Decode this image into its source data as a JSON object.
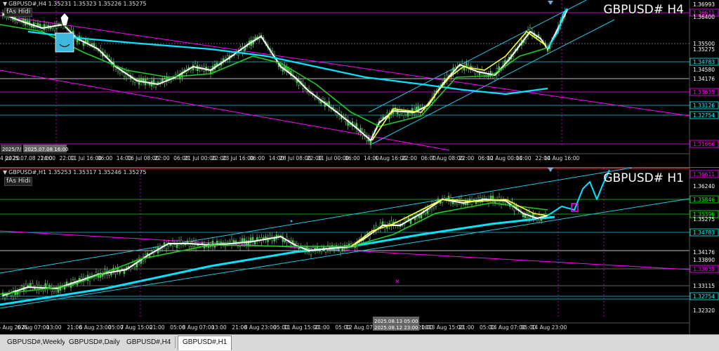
{
  "tabs": [
    {
      "label": "GBPUSD#,Weekly"
    },
    {
      "label": "GBPUSD#,Daily"
    },
    {
      "label": "GBPUSD#,H4"
    },
    {
      "label": "GBPUSD#,H1"
    }
  ],
  "h4": {
    "header": "GBPUSD#,H4  1.35231 1.35323 1.35226 1.35275",
    "hide_label": "fAs Hidi",
    "title": "GBPUSD# H4",
    "x_ticks": [
      "4 Jul 20",
      "2025.07.08 22:00",
      "14:00",
      "22:00",
      "11 Jul 16:00",
      "06:00",
      "14:00",
      "16 Jul 08:00",
      "22:00",
      "06:00",
      "21 Jul 00:00",
      "22:00",
      "23 Jul 16:00",
      "06:00",
      "14:00",
      "28 Jul 08:00",
      "22:00",
      "31 Jul 00:00",
      "06:00",
      "14:00",
      "4 Aug 16:00",
      "22:00",
      "06:00",
      "7 Aug 08:00",
      "22:00",
      "06:00",
      "12 Aug 00:00",
      "14:00",
      "22:00",
      "14 Aug 16:00"
    ],
    "cursor_dates": [
      "2025/7/",
      "2025.07.08 16:00"
    ],
    "price_labels": [
      {
        "text": "1.36993",
        "color": "#ffffff"
      },
      {
        "text": "1.36611",
        "color": "#ff00ff"
      },
      {
        "text": "1.36400",
        "color": "#ffffff"
      },
      {
        "text": "1.35500",
        "color": "#ffffff"
      },
      {
        "text": "1.35275",
        "color": "#ffffff"
      },
      {
        "text": "1.34783",
        "color": "#00ffff"
      },
      {
        "text": "1.34580",
        "color": "#ffffff"
      },
      {
        "text": "1.34176",
        "color": "#ffffff"
      },
      {
        "text": "1.33635",
        "color": "#ff00ff"
      },
      {
        "text": "1.33126",
        "color": "#00ffff"
      },
      {
        "text": "1.32754",
        "color": "#00ffff"
      },
      {
        "text": "1.31666",
        "color": "#ff00ff"
      }
    ]
  },
  "h1": {
    "header": "GBPUSD#,H1  1.35253 1.35317 1.35246 1.35275",
    "hide_label": "fAs Hidi",
    "title": "GBPUSD# H1",
    "x_ticks": [
      "5 Aug 2025",
      "6 Aug 07:00",
      "13:00",
      "21:00",
      "6 Aug 23:00",
      "05:00",
      "7 Aug 15:00",
      "21:00",
      "05:00",
      "8 Aug 07:00",
      "13:00",
      "21:00",
      "8 Aug 23:00",
      "05:00",
      "11 Aug 15:00",
      "21:00",
      "05:00",
      "12 Aug 07:00",
      "13:00",
      "2025.08.13 05:00",
      "21:00",
      "13 Aug 15:00",
      "21:00",
      "05:00",
      "14 Aug 07:00",
      "05:00",
      "14 Aug 23:00"
    ],
    "cursor_dates": [
      "2025/8/5 05:00",
      "2025.08.13 05:00",
      "2025.08.12 23:00"
    ],
    "price_labels": [
      {
        "text": "1.36611",
        "color": "#ff00ff"
      },
      {
        "text": "1.36240",
        "color": "#ffffff"
      },
      {
        "text": "1.35846",
        "color": "#00ff00"
      },
      {
        "text": "1.35396",
        "color": "#00ff00"
      },
      {
        "text": "1.35275",
        "color": "#ffffff"
      },
      {
        "text": "1.34783",
        "color": "#00ffff"
      },
      {
        "text": "1.34176",
        "color": "#ffffff"
      },
      {
        "text": "1.33890",
        "color": "#ffffff"
      },
      {
        "text": "1.33635",
        "color": "#ff00ff"
      },
      {
        "text": "1.33115",
        "color": "#ffffff"
      },
      {
        "text": "1.32754",
        "color": "#00ffff"
      },
      {
        "text": "1.32320",
        "color": "#ffffff"
      }
    ]
  },
  "colors": {
    "white": "#ffffff",
    "green": "#1fd01f",
    "yellow": "#ffff33",
    "cyan": "#00e5ff",
    "magenta": "#ff00ff",
    "aqua": "#1ec8e8"
  }
}
